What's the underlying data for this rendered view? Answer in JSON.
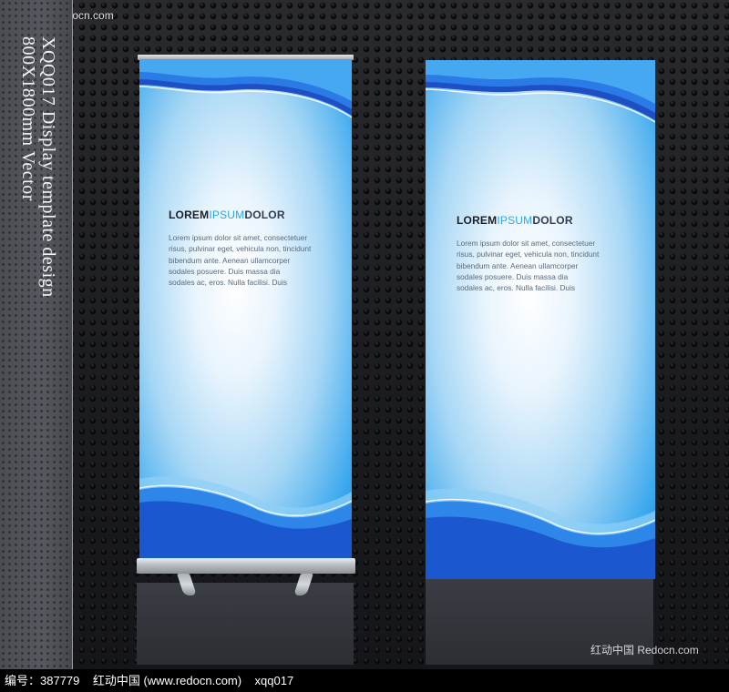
{
  "watermark": {
    "top_left": "红动中国  Redocn.com",
    "bottom_right": "红动中国  Redocn.com"
  },
  "side_panel": {
    "line1": "XQQ017 Display template design",
    "line2": "800X1800mm Vector"
  },
  "banners": [
    {
      "headline_parts": [
        "LOREM",
        "IPSUM",
        "DOLOR"
      ],
      "body_lines": [
        "Lorem ipsum dolor sit amet, consectetuer",
        "risus, pulvinar eget, vehicula non, tincidunt",
        "bibendum ante. Aenean ullamcorper",
        "sodales posuere. Duis massa dia",
        "sodales ac, eros. Nulla facilisi. Duis"
      ]
    },
    {
      "headline_parts": [
        "LOREM",
        "IPSUM",
        "DOLOR"
      ],
      "body_lines": [
        "Lorem ipsum dolor sit amet, consectetuer",
        "risus, pulvinar eget, vehicula non, tincidunt",
        "bibendum ante. Aenean ullamcorper",
        "sodales posuere. Duis massa dia",
        "sodales ac, eros. Nulla facilisi. Duis"
      ]
    }
  ],
  "footer": {
    "text": "编号：387779    红动中国 (www.redocn.com)    xqq017"
  },
  "colors": {
    "banner_blue": "#1b8ee6",
    "headline_accent": "#2aa6e8",
    "background_dark": "#1c1d20"
  }
}
